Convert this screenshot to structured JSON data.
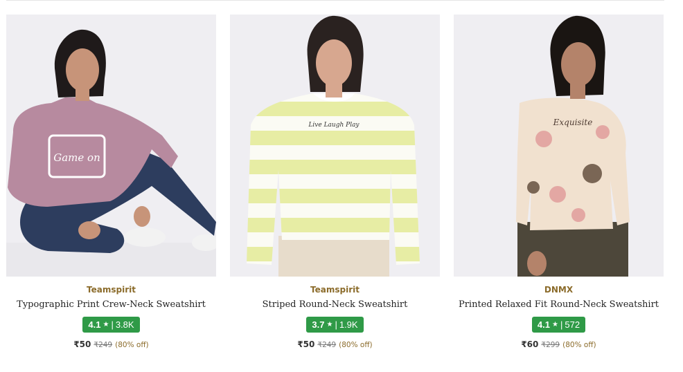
{
  "products": [
    {
      "brand": "Teamspirit",
      "title": "Typographic Print Crew-Neck Sweatshirt",
      "rating": "4.1",
      "reviews": "3.8K",
      "price": "₹50",
      "mrp": "₹249",
      "discount": "(80% off)",
      "image": {
        "kind": "seated-model",
        "top_color": "#b78a9f",
        "bottom_color": "#2d3d5e",
        "print_text": "Game on"
      }
    },
    {
      "brand": "Teamspirit",
      "title": "Striped Round-Neck Sweatshirt",
      "rating": "3.7",
      "reviews": "1.9K",
      "price": "₹50",
      "mrp": "₹249",
      "discount": "(80% off)",
      "image": {
        "kind": "standing-model",
        "top_color": "#e7eda4",
        "bottom_color": "#e7dccb",
        "print_text": "Live Laugh Play"
      }
    },
    {
      "brand": "DNMX",
      "title": "Printed Relaxed Fit Round-Neck Sweatshirt",
      "rating": "4.1",
      "reviews": "572",
      "price": "₹60",
      "mrp": "₹299",
      "discount": "(80% off)",
      "image": {
        "kind": "standing-model",
        "top_color": "#f1e1cf",
        "bottom_color": "#4d473a",
        "print_text": "Exquisite"
      }
    }
  ],
  "icons": {
    "rating_star": "star-icon"
  },
  "colors": {
    "brand_text": "#8b6b2a",
    "rating_badge": "#2f9a47",
    "discount_text": "#8b6b2a"
  }
}
